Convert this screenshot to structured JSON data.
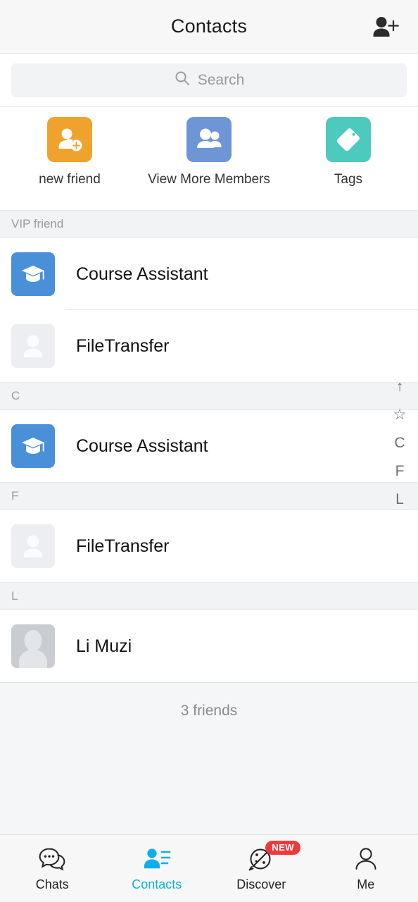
{
  "header": {
    "title": "Contacts",
    "add_friend_icon": "add-person-icon"
  },
  "search": {
    "placeholder": "Search",
    "icon": "search-icon"
  },
  "shortcuts": [
    {
      "label": "new friend",
      "icon": "person-add-icon",
      "color": "#EFA32C"
    },
    {
      "label": "View More Members",
      "icon": "group-icon",
      "color": "#6E96D6"
    },
    {
      "label": "Tags",
      "icon": "tag-icon",
      "color": "#4DC9BE"
    }
  ],
  "sections": [
    {
      "title": "VIP friend",
      "contacts": [
        {
          "name": "Course Assistant",
          "avatar": "graduation-cap-avatar"
        },
        {
          "name": "FileTransfer",
          "avatar": "person-placeholder-avatar"
        }
      ]
    },
    {
      "title": "C",
      "contacts": [
        {
          "name": "Course Assistant",
          "avatar": "graduation-cap-avatar"
        }
      ]
    },
    {
      "title": "F",
      "contacts": [
        {
          "name": "FileTransfer",
          "avatar": "person-placeholder-avatar"
        }
      ]
    },
    {
      "title": "L",
      "contacts": [
        {
          "name": "Li Muzi",
          "avatar": "photo-silhouette-avatar"
        }
      ]
    }
  ],
  "list_footer": {
    "count_text": "3 friends"
  },
  "index_rail": [
    "↑",
    "☆",
    "C",
    "F",
    "L"
  ],
  "tabbar": {
    "active": "Contacts",
    "accent_color": "#0FAEEA",
    "badge_color": "#F0393E",
    "tabs": [
      {
        "label": "Chats",
        "icon": "chat-bubbles-icon",
        "badge": ""
      },
      {
        "label": "Contacts",
        "icon": "contacts-person-icon",
        "badge": ""
      },
      {
        "label": "Discover",
        "icon": "discover-planet-icon",
        "badge": "NEW"
      },
      {
        "label": "Me",
        "icon": "person-outline-icon",
        "badge": ""
      }
    ]
  }
}
